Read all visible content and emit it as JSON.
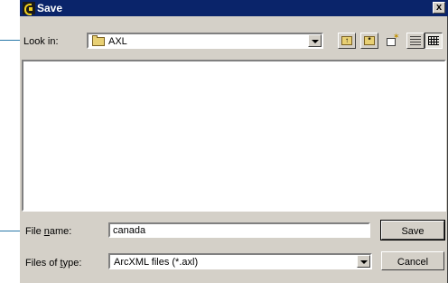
{
  "window": {
    "title": "Save",
    "close_label": "x"
  },
  "look_in": {
    "label": "Look in:",
    "value": "AXL"
  },
  "file_name": {
    "label": "File name:",
    "value": "canada"
  },
  "file_type": {
    "label": "Files of type:",
    "value": "ArcXML files (*.axl)"
  },
  "buttons": {
    "save": "Save",
    "cancel": "Cancel"
  },
  "colors": {
    "titlebar": "#0a246a",
    "dialog": "#d4d0c8",
    "pointer": "#2a78a8"
  }
}
